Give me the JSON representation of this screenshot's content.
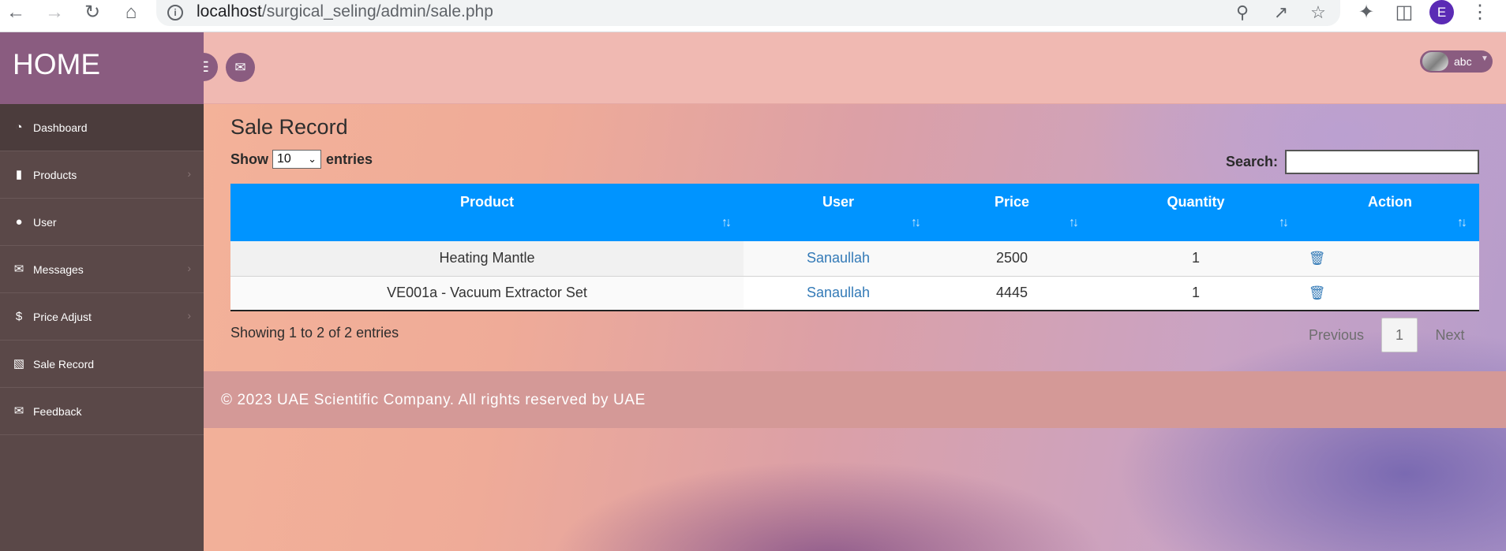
{
  "browser": {
    "url_host": "localhost",
    "url_path": "/surgical_seling/admin/sale.php",
    "profile_initial": "E"
  },
  "sidebar": {
    "brand": "HOME",
    "items": [
      {
        "label": "Dashboard",
        "icon": "dashboard-icon",
        "active": true,
        "has_arrow": false
      },
      {
        "label": "Products",
        "icon": "book-icon",
        "active": false,
        "has_arrow": true
      },
      {
        "label": "User",
        "icon": "users-icon",
        "active": false,
        "has_arrow": false
      },
      {
        "label": "Messages",
        "icon": "envelope-icon",
        "active": false,
        "has_arrow": true
      },
      {
        "label": "Price Adjust",
        "icon": "dollar-icon",
        "active": false,
        "has_arrow": true
      },
      {
        "label": "Sale Record",
        "icon": "bar-chart-icon",
        "active": false,
        "has_arrow": false
      },
      {
        "label": "Feedback",
        "icon": "envelope-outline-icon",
        "active": false,
        "has_arrow": false
      }
    ]
  },
  "header": {
    "user_name": "abc"
  },
  "main": {
    "title": "Sale Record",
    "length": {
      "prefix": "Show",
      "value": "10",
      "suffix": "entries"
    },
    "search": {
      "label": "Search:",
      "value": ""
    },
    "columns": [
      "Product",
      "User",
      "Price",
      "Quantity",
      "Action"
    ],
    "rows": [
      {
        "product": "Heating Mantle",
        "user": "Sanaullah",
        "price": "2500",
        "quantity": "1"
      },
      {
        "product": "VE001a - Vacuum Extractor Set",
        "user": "Sanaullah",
        "price": "4445",
        "quantity": "1"
      }
    ],
    "info": "Showing 1 to 2 of 2 entries",
    "pagination": {
      "previous": "Previous",
      "current": "1",
      "next": "Next"
    }
  },
  "footer": {
    "text": "© 2023 UAE Scientific Company. All rights reserved by UAE"
  },
  "colors": {
    "sidebar_bg": "#5a4848",
    "brand_bg": "#8a5c80",
    "table_header": "#0094ff",
    "link": "#337ab7"
  }
}
